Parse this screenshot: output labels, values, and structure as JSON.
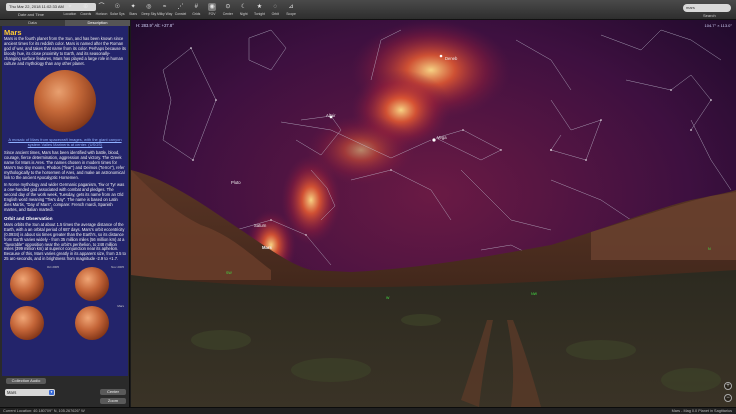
{
  "toolbar": {
    "datetime": "Thu Mar 22, 2018  11:02:33 AM",
    "datetime_label": "Date and Time",
    "tools": [
      {
        "label": "Location",
        "icon": "pin-icon",
        "glyph": "⌖"
      },
      {
        "label": "Coords",
        "icon": "coords-icon",
        "glyph": "⊕"
      },
      {
        "label": "Horizon",
        "icon": "horizon-icon",
        "glyph": "⌒"
      },
      {
        "label": "Solar Sys",
        "icon": "solar-system-icon",
        "glyph": "☉"
      },
      {
        "label": "Stars",
        "icon": "stars-icon",
        "glyph": "✦"
      },
      {
        "label": "Deep Sky",
        "icon": "deep-sky-icon",
        "glyph": "◎"
      },
      {
        "label": "Milky Way",
        "icon": "milky-way-icon",
        "glyph": "≈"
      },
      {
        "label": "Constel",
        "icon": "constellation-icon",
        "glyph": "⋰"
      },
      {
        "label": "Grids",
        "icon": "grids-icon",
        "glyph": "#"
      },
      {
        "label": "FOV",
        "icon": "fov-icon",
        "glyph": "◉",
        "active": true
      },
      {
        "label": "Center",
        "icon": "center-icon",
        "glyph": "⊙"
      },
      {
        "label": "Night",
        "icon": "night-icon",
        "glyph": "☾"
      },
      {
        "label": "Tonight",
        "icon": "tonight-icon",
        "glyph": "★"
      },
      {
        "label": "Orbit",
        "icon": "orbit-icon",
        "glyph": "◌"
      },
      {
        "label": "Scope",
        "icon": "scope-icon",
        "glyph": "⊿"
      }
    ],
    "search_value": "mars",
    "search_label": "Search"
  },
  "sidebar": {
    "tabs": [
      "Data",
      "Description"
    ],
    "selected_tab": 1,
    "title": "Mars",
    "intro": "Mars is the fourth planet from the Sun, and has been known since ancient times for its reddish color. Mars is named after the Roman god of war, and takes that name from its color. Perhaps because its bloody hue, its close proximity to Earth, and its seasonally-changing surface features, Mars has played a large role in human culture and mythology than any other planet.",
    "image_caption": "A mosaic of Mars from spacecraft images, with the giant canyon system Valles Marineris at center. (USGS)",
    "history": "Since ancient times, Mars has been identified with battle, blood, courage, fierce determination, aggression and victory. The Greek name for Mars is Ares. The names chosen in modern times for Mars's two tiny moons, Phobos (\"fear\") and Deimos (\"terror\"), refer mythologically to the horsemen of Ares, and make an astronomical link to the ancient Apocalyptic Horsemen.",
    "norse": "In Norse mythology and wider Germanic paganism, Tiw or Tyr was a one-handed god associated with combat and pledges. The second day of the work week, Tuesday, gets its name from an Old English word meaning \"Tiw's day\". The name is based on Latin dies Martis, \"Day of Mars\", compare: French mardi, Spanish martes, and Italian martedì.",
    "orbit_heading": "Orbit and Observation",
    "orbit_text": "Mars orbits the Sun at about 1.5 times the average distance of the Earth, with a an orbital period of 687 days. Mars's orbit eccentricity (0.0934) is about six times greater than the Earth's, so its distance from Earth varies widely - from 35 million miles (56 million km) at a \"favorable\" opposition near the orbit's perihelion, to 248 million miles (399 million km) at superior conjunction near its aphelion. Because of this, Mars varies greatly in its apparent size, from 3.5 to 25 arc-seconds, and in brightness from magnitude -2.9 to +1.7.",
    "thumb_captions": [
      "Oct 2005",
      "Nov 2005",
      "",
      "Mars"
    ],
    "audio_button": "Collection Audio",
    "object_select": "Mars",
    "center_button": "Center",
    "zoom_button": "Zoom"
  },
  "sky": {
    "coords": "H: 283.9° Alt: +27.8°",
    "fov": "104.7° × 113.0°",
    "labels": {
      "deneb": "Deneb",
      "altair": "Altair",
      "vega": "Vega",
      "pluto": "Pluto",
      "saturn": "Saturn",
      "mars": "Mars"
    },
    "directions": [
      "SW",
      "W",
      "NW",
      "N"
    ]
  },
  "status": {
    "location": "Current Location: 40.180709° N, 105.267626° W",
    "object": "Mars - Mag 0.0  Planet in Sagittarius"
  }
}
